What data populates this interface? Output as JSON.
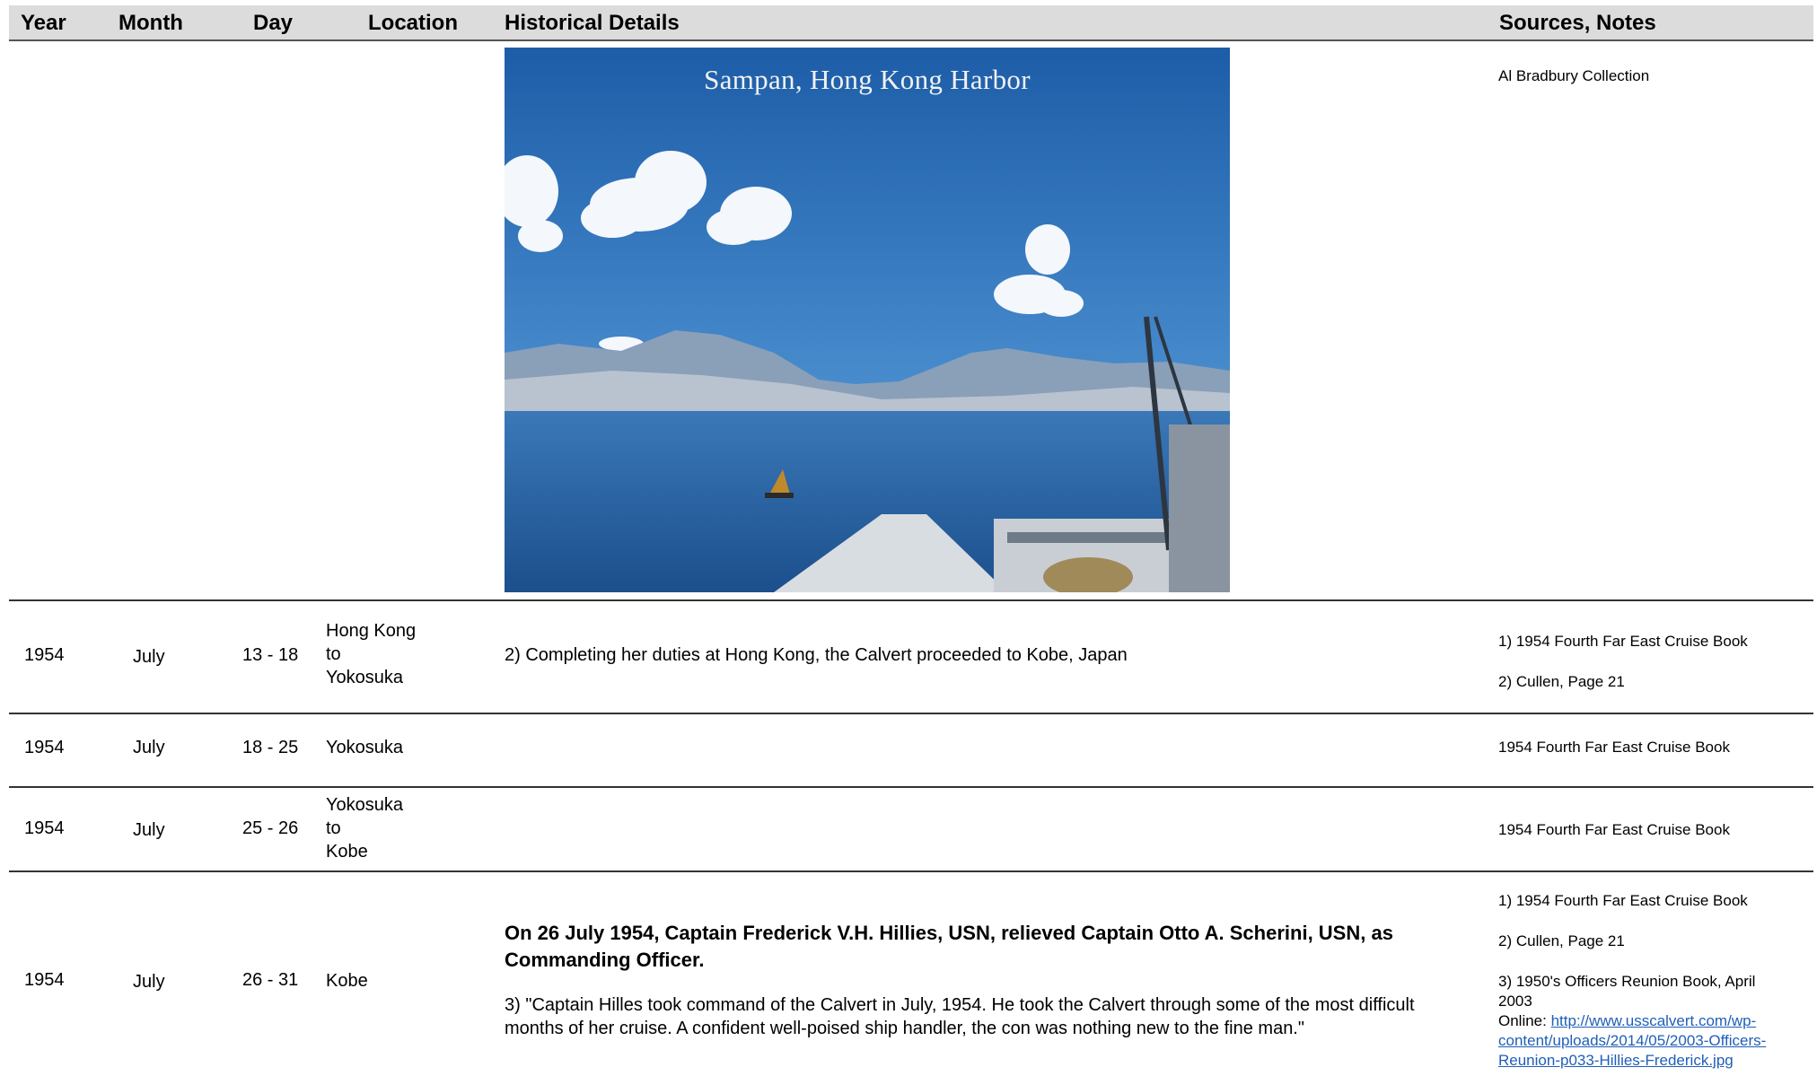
{
  "headers": {
    "year": "Year",
    "month": "Month",
    "day": "Day",
    "location": "Location",
    "details": "Historical Details",
    "sources": "Sources, Notes"
  },
  "photo_row": {
    "caption": "Sampan, Hong Kong Harbor",
    "source": "Al Bradbury Collection"
  },
  "rows": [
    {
      "year": "1954",
      "month": "July",
      "day": "13 - 18",
      "location_lines": [
        "Hong Kong",
        "to",
        "Yokosuka"
      ],
      "detail": "2) Completing her duties at Hong Kong, the Calvert proceeded to Kobe, Japan",
      "sources": [
        "1) 1954 Fourth Far East Cruise Book",
        "2) Cullen, Page 21"
      ]
    },
    {
      "year": "1954",
      "month": "July",
      "day": "18 - 25",
      "location_lines": [
        "Yokosuka"
      ],
      "detail": "",
      "sources": [
        "1954 Fourth Far East Cruise Book"
      ]
    },
    {
      "year": "1954",
      "month": "July",
      "day": "25 - 26",
      "location_lines": [
        "Yokosuka",
        "to",
        "Kobe"
      ],
      "detail": "",
      "sources": [
        "1954 Fourth Far East Cruise Book"
      ]
    },
    {
      "year": "1954",
      "month": "July",
      "day": "26 - 31",
      "location_lines": [
        "Kobe"
      ],
      "detail_bold_lines": [
        "On 26 July 1954, Captain Frederick V.H. Hillies, USN, relieved Captain Otto A. Scherini, USN, as",
        "Commanding Officer."
      ],
      "detail_lines": [
        "3) \"Captain Hilles took command of the Calvert in July, 1954. He took the Calvert through some of the most difficult",
        "months of her cruise. A confident well-poised ship handler, the con was nothing new to the fine man.\""
      ],
      "sources": [
        "1) 1954 Fourth Far East Cruise Book",
        "2) Cullen, Page 21"
      ],
      "source3_lines": [
        "3) 1950's Officers Reunion Book, April",
        "2003"
      ],
      "online_label": "Online: ",
      "online_link_lines": [
        "http://www.usscalvert.com/wp-",
        "content/uploads/2014/05/2003-Officers-",
        "Reunion-p033-Hillies-Frederick.jpg"
      ]
    }
  ],
  "colors": {
    "header_bg": "#dcdcdc",
    "link": "#1f5fb8",
    "rule": "#333333"
  },
  "icons": [
    "photo-image"
  ]
}
